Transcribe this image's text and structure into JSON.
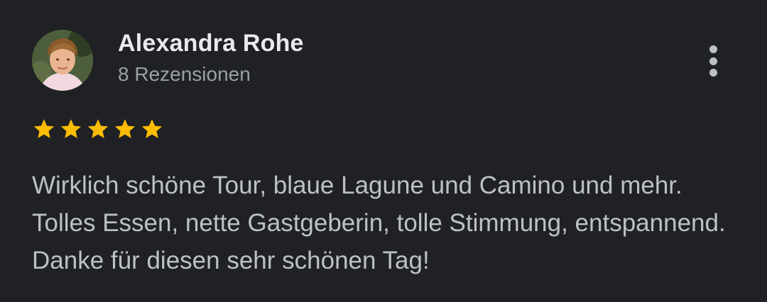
{
  "review": {
    "author_name": "Alexandra Rohe",
    "review_count": "8 Rezensionen",
    "rating": 5,
    "rating_max": 5,
    "text": "Wirklich schöne Tour, blaue Lagune und Camino und mehr. Tolles Essen, nette Gastgeberin, tolle Stimmung, entspannend. Danke für diesen sehr schönen Tag!",
    "avatar_icon": "user-photo",
    "more_icon": "more-vert-icon"
  },
  "colors": {
    "background": "#202124",
    "star": "#fbbc04",
    "name": "#e8eaed",
    "secondary": "#9aa0a6",
    "body_text": "#bdc1c6"
  }
}
